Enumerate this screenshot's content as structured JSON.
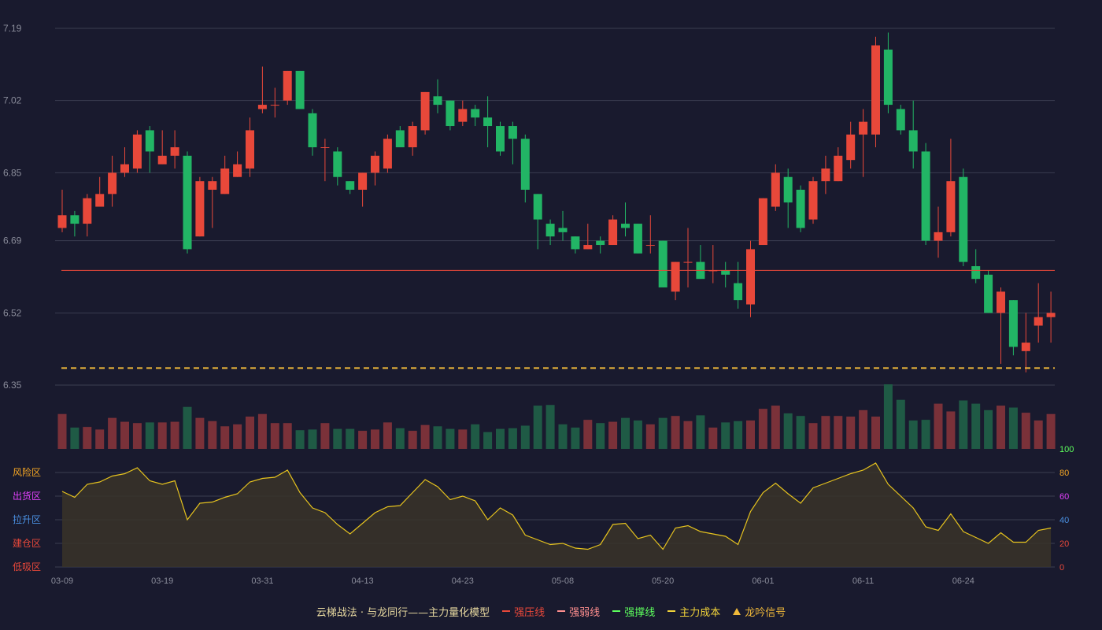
{
  "colors": {
    "background": "#191a2e",
    "up": "#e8483a",
    "down": "#22b565",
    "vol_up": "#7a3139",
    "vol_down": "#1f5a45",
    "grid": "#3a3d50",
    "axis_text": "#8a8c9a",
    "resistance": "#e8483a",
    "cost": "#f0b93a",
    "oscillator": "#e6c31e",
    "oscillator_fill": "#3a3428"
  },
  "legend": {
    "title": "云梯战法 · 与龙同行——主力量化模型",
    "items": [
      {
        "label": "强压线",
        "color": "#e8483a",
        "style": "solid"
      },
      {
        "label": "强弱线",
        "color": "#ff8f8f",
        "style": "dashed"
      },
      {
        "label": "强撑线",
        "color": "#5dff5d",
        "style": "solid"
      },
      {
        "label": "主力成本",
        "color": "#f0d23a",
        "style": "dashed"
      },
      {
        "label": "龙吟信号",
        "color": "#f0b93a",
        "style": "triangle"
      }
    ]
  },
  "zone_labels": [
    {
      "label": "风险区",
      "value": 80,
      "color": "#f5a623"
    },
    {
      "label": "出货区",
      "value": 60,
      "color": "#e040fb"
    },
    {
      "label": "拉升区",
      "value": 40,
      "color": "#4a90e2"
    },
    {
      "label": "建仓区",
      "value": 20,
      "color": "#e8483a"
    },
    {
      "label": "低吸区",
      "value": 0,
      "color": "#e8483a"
    }
  ],
  "chart_data": {
    "type": "candlestick",
    "price_axis": {
      "ticks": [
        "7.19",
        "7.02",
        "6.85",
        "6.69",
        "6.52",
        "6.35"
      ],
      "min": 6.35,
      "max": 7.19
    },
    "x_tick_labels": [
      {
        "index": 0,
        "label": "03-09"
      },
      {
        "index": 8,
        "label": "03-19"
      },
      {
        "index": 16,
        "label": "03-31"
      },
      {
        "index": 24,
        "label": "04-13"
      },
      {
        "index": 32,
        "label": "04-23"
      },
      {
        "index": 40,
        "label": "05-08"
      },
      {
        "index": 48,
        "label": "05-20"
      },
      {
        "index": 56,
        "label": "06-01"
      },
      {
        "index": 64,
        "label": "06-11"
      },
      {
        "index": 72,
        "label": "06-24"
      }
    ],
    "candles": [
      [
        6.72,
        6.75,
        6.81,
        6.71
      ],
      [
        6.75,
        6.73,
        6.76,
        6.7
      ],
      [
        6.73,
        6.79,
        6.8,
        6.7
      ],
      [
        6.77,
        6.8,
        6.84,
        6.77
      ],
      [
        6.8,
        6.85,
        6.89,
        6.77
      ],
      [
        6.85,
        6.87,
        6.91,
        6.84
      ],
      [
        6.86,
        6.94,
        6.95,
        6.85
      ],
      [
        6.95,
        6.9,
        6.96,
        6.85
      ],
      [
        6.87,
        6.89,
        6.95,
        6.87
      ],
      [
        6.89,
        6.91,
        6.95,
        6.86
      ],
      [
        6.89,
        6.67,
        6.9,
        6.66
      ],
      [
        6.7,
        6.83,
        6.84,
        6.7
      ],
      [
        6.81,
        6.83,
        6.84,
        6.72
      ],
      [
        6.8,
        6.86,
        6.89,
        6.8
      ],
      [
        6.84,
        6.87,
        6.9,
        6.84
      ],
      [
        6.86,
        6.95,
        6.98,
        6.84
      ],
      [
        7.0,
        7.01,
        7.1,
        6.99
      ],
      [
        7.01,
        7.01,
        7.05,
        6.98
      ],
      [
        7.02,
        7.09,
        7.09,
        7.01
      ],
      [
        7.09,
        7.0,
        7.09,
        7.0
      ],
      [
        6.99,
        6.91,
        7.0,
        6.89
      ],
      [
        6.91,
        6.91,
        6.93,
        6.83
      ],
      [
        6.9,
        6.84,
        6.91,
        6.82
      ],
      [
        6.83,
        6.81,
        6.83,
        6.8
      ],
      [
        6.81,
        6.85,
        6.85,
        6.77
      ],
      [
        6.85,
        6.89,
        6.9,
        6.82
      ],
      [
        6.86,
        6.93,
        6.94,
        6.85
      ],
      [
        6.95,
        6.91,
        6.96,
        6.91
      ],
      [
        6.91,
        6.96,
        6.97,
        6.89
      ],
      [
        6.95,
        7.04,
        7.04,
        6.94
      ],
      [
        7.03,
        7.01,
        7.07,
        6.99
      ],
      [
        7.02,
        6.96,
        7.02,
        6.95
      ],
      [
        6.97,
        7.0,
        7.02,
        6.96
      ],
      [
        7.0,
        6.98,
        7.01,
        6.96
      ],
      [
        6.98,
        6.96,
        7.03,
        6.91
      ],
      [
        6.96,
        6.9,
        6.97,
        6.89
      ],
      [
        6.96,
        6.93,
        6.97,
        6.87
      ],
      [
        6.93,
        6.81,
        6.94,
        6.78
      ],
      [
        6.8,
        6.74,
        6.8,
        6.67
      ],
      [
        6.73,
        6.7,
        6.74,
        6.68
      ],
      [
        6.72,
        6.71,
        6.76,
        6.69
      ],
      [
        6.7,
        6.67,
        6.7,
        6.66
      ],
      [
        6.67,
        6.68,
        6.73,
        6.67
      ],
      [
        6.69,
        6.68,
        6.7,
        6.66
      ],
      [
        6.68,
        6.74,
        6.75,
        6.68
      ],
      [
        6.73,
        6.72,
        6.78,
        6.7
      ],
      [
        6.73,
        6.66,
        6.73,
        6.66
      ],
      [
        6.68,
        6.68,
        6.75,
        6.66
      ],
      [
        6.69,
        6.58,
        6.69,
        6.58
      ],
      [
        6.57,
        6.64,
        6.64,
        6.55
      ],
      [
        6.64,
        6.64,
        6.72,
        6.58
      ],
      [
        6.64,
        6.6,
        6.68,
        6.6
      ],
      [
        6.62,
        6.62,
        6.68,
        6.59
      ],
      [
        6.62,
        6.61,
        6.64,
        6.58
      ],
      [
        6.59,
        6.55,
        6.64,
        6.53
      ],
      [
        6.54,
        6.67,
        6.69,
        6.51
      ],
      [
        6.68,
        6.79,
        6.79,
        6.68
      ],
      [
        6.77,
        6.85,
        6.87,
        6.76
      ],
      [
        6.84,
        6.78,
        6.86,
        6.72
      ],
      [
        6.81,
        6.72,
        6.82,
        6.71
      ],
      [
        6.74,
        6.83,
        6.84,
        6.73
      ],
      [
        6.83,
        6.86,
        6.89,
        6.8
      ],
      [
        6.83,
        6.89,
        6.91,
        6.83
      ],
      [
        6.88,
        6.94,
        6.97,
        6.86
      ],
      [
        6.94,
        6.97,
        7.0,
        6.84
      ],
      [
        6.94,
        7.15,
        7.17,
        6.91
      ],
      [
        7.14,
        7.01,
        7.18,
        6.99
      ],
      [
        7.0,
        6.95,
        7.01,
        6.94
      ],
      [
        6.95,
        6.9,
        7.02,
        6.86
      ],
      [
        6.9,
        6.69,
        6.92,
        6.68
      ],
      [
        6.69,
        6.71,
        6.77,
        6.65
      ],
      [
        6.71,
        6.83,
        6.93,
        6.7
      ],
      [
        6.84,
        6.64,
        6.86,
        6.63
      ],
      [
        6.63,
        6.6,
        6.67,
        6.59
      ],
      [
        6.61,
        6.52,
        6.62,
        6.52
      ],
      [
        6.52,
        6.57,
        6.58,
        6.4
      ],
      [
        6.55,
        6.44,
        6.55,
        6.42
      ],
      [
        6.43,
        6.45,
        6.52,
        6.38
      ],
      [
        6.49,
        6.51,
        6.59,
        6.45
      ],
      [
        6.51,
        6.52,
        6.57,
        6.45
      ]
    ],
    "volume": [
      54,
      33,
      34,
      30,
      48,
      42,
      40,
      41,
      41,
      42,
      65,
      48,
      43,
      35,
      38,
      50,
      54,
      40,
      40,
      29,
      30,
      40,
      31,
      31,
      28,
      30,
      41,
      32,
      28,
      37,
      35,
      31,
      30,
      38,
      26,
      31,
      32,
      36,
      67,
      68,
      38,
      33,
      45,
      40,
      42,
      48,
      44,
      38,
      48,
      51,
      43,
      52,
      33,
      41,
      43,
      44,
      62,
      67,
      55,
      51,
      40,
      51,
      51,
      50,
      60,
      50,
      100,
      76,
      44,
      45,
      70,
      58,
      75,
      70,
      60,
      67,
      64,
      56,
      44,
      54
    ],
    "resistance_level": 6.62,
    "main_cost_level": 6.39,
    "oscillator": {
      "ticks": [
        100,
        80,
        60,
        40,
        20,
        0
      ],
      "tick_colors": [
        "#5dff5d",
        "#f5a623",
        "#e040fb",
        "#4a90e2",
        "#e8483a",
        "#e8483a"
      ],
      "values": [
        64,
        59,
        70,
        72,
        77,
        79,
        84,
        73,
        70,
        73,
        40,
        54,
        55,
        59,
        62,
        72,
        75,
        76,
        82,
        63,
        50,
        46,
        36,
        28,
        37,
        46,
        51,
        52,
        63,
        74,
        68,
        57,
        60,
        56,
        40,
        50,
        44,
        27,
        23,
        19,
        20,
        16,
        15,
        19,
        36,
        37,
        24,
        27,
        15,
        33,
        35,
        30,
        28,
        26,
        19,
        47,
        63,
        71,
        62,
        54,
        67,
        71,
        75,
        79,
        82,
        88,
        70,
        60,
        50,
        34,
        31,
        45,
        30,
        25,
        20,
        29,
        21,
        21,
        31,
        33
      ]
    }
  }
}
